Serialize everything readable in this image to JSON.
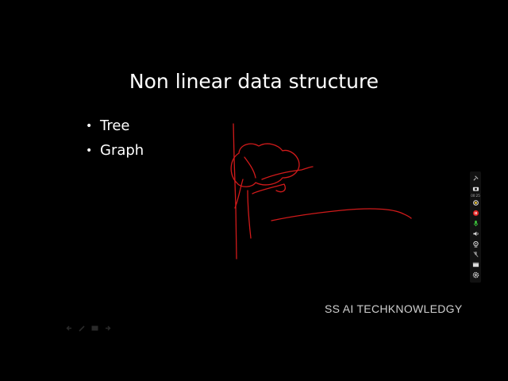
{
  "slide": {
    "title": "Non linear data structure",
    "bullets": [
      "Tree",
      "Graph"
    ],
    "bullet_symbol": "•",
    "watermark": "SS AI TECHKNOWLEDGY"
  },
  "colors": {
    "background": "#000000",
    "text": "#ffffff",
    "ink": "#d11a1a",
    "watermark": "#cfcfcf"
  },
  "slide_controls": {
    "icons": [
      "previous-arrow-icon",
      "pen-icon",
      "slides-icon",
      "next-arrow-icon"
    ]
  },
  "recorder_toolbar": {
    "time": "00:25",
    "icons": [
      "pin-icon",
      "camera-icon",
      "brightness-icon",
      "record-icon",
      "microphone-icon",
      "volume-icon",
      "webcam-icon",
      "mic-off-icon",
      "layout-icon",
      "settings-icon"
    ]
  }
}
